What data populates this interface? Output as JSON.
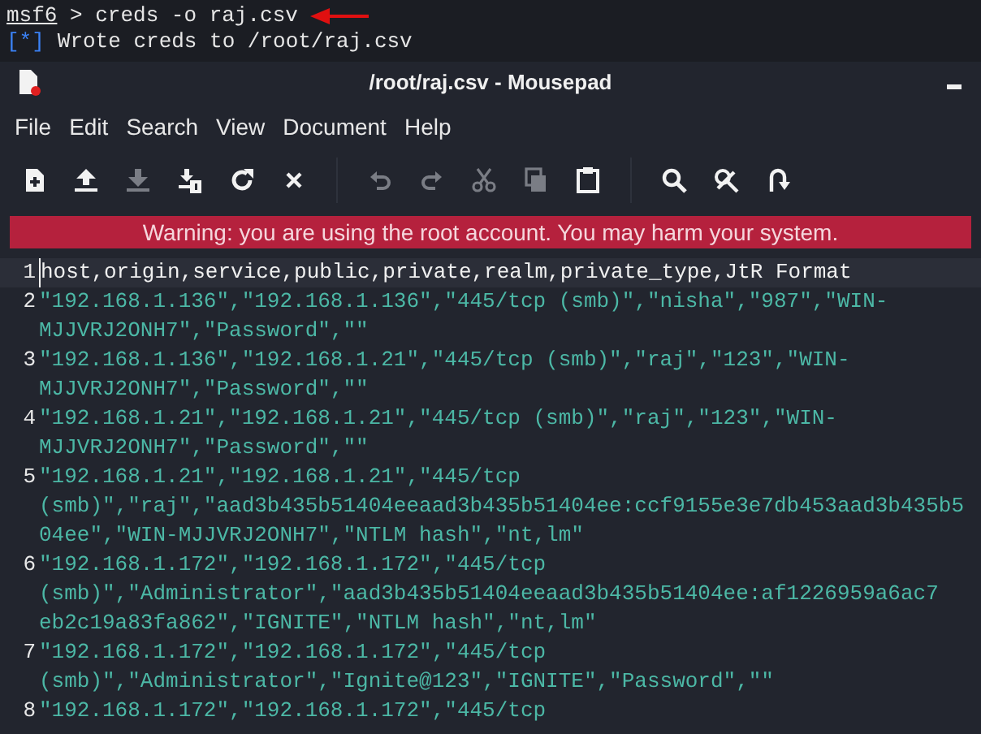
{
  "terminal": {
    "prompt": "msf6",
    "command": " > creds -o raj.csv",
    "output_marker": "[*]",
    "output": "Wrote creds to /root/raj.csv"
  },
  "window": {
    "title": "/root/raj.csv - Mousepad"
  },
  "menu": [
    "File",
    "Edit",
    "Search",
    "View",
    "Document",
    "Help"
  ],
  "toolbar": [
    {
      "kind": "new",
      "disabled": false
    },
    {
      "kind": "open",
      "disabled": false
    },
    {
      "kind": "save",
      "disabled": true
    },
    {
      "kind": "save-as",
      "disabled": false
    },
    {
      "kind": "reload",
      "disabled": false
    },
    {
      "kind": "close",
      "disabled": false
    },
    {
      "kind": "sep"
    },
    {
      "kind": "undo",
      "disabled": true
    },
    {
      "kind": "redo",
      "disabled": true
    },
    {
      "kind": "cut",
      "disabled": true
    },
    {
      "kind": "copy",
      "disabled": true
    },
    {
      "kind": "paste",
      "disabled": false
    },
    {
      "kind": "sep"
    },
    {
      "kind": "find",
      "disabled": false
    },
    {
      "kind": "replace",
      "disabled": false
    },
    {
      "kind": "goto",
      "disabled": false
    }
  ],
  "warning": "Warning: you are using the root account. You may harm your system.",
  "lines": [
    {
      "number": "1",
      "current": true,
      "header": true,
      "rows": [
        "host,origin,service,public,private,realm,private_type,JtR Format"
      ]
    },
    {
      "number": "2",
      "current": false,
      "header": false,
      "rows": [
        "\"192.168.1.136\",\"192.168.1.136\",\"445/tcp (smb)\",\"nisha\",\"987\",\"WIN-",
        "MJJVRJ2ONH7\",\"Password\",\"\""
      ]
    },
    {
      "number": "3",
      "current": false,
      "header": false,
      "rows": [
        "\"192.168.1.136\",\"192.168.1.21\",\"445/tcp (smb)\",\"raj\",\"123\",\"WIN-",
        "MJJVRJ2ONH7\",\"Password\",\"\""
      ]
    },
    {
      "number": "4",
      "current": false,
      "header": false,
      "rows": [
        "\"192.168.1.21\",\"192.168.1.21\",\"445/tcp (smb)\",\"raj\",\"123\",\"WIN-",
        "MJJVRJ2ONH7\",\"Password\",\"\""
      ]
    },
    {
      "number": "5",
      "current": false,
      "header": false,
      "rows": [
        "\"192.168.1.21\",\"192.168.1.21\",\"445/tcp",
        "(smb)\",\"raj\",\"aad3b435b51404eeaad3b435b51404ee:ccf9155e3e7db453aad3b435b5",
        "04ee\",\"WIN-MJJVRJ2ONH7\",\"NTLM hash\",\"nt,lm\""
      ]
    },
    {
      "number": "6",
      "current": false,
      "header": false,
      "rows": [
        "\"192.168.1.172\",\"192.168.1.172\",\"445/tcp",
        "(smb)\",\"Administrator\",\"aad3b435b51404eeaad3b435b51404ee:af1226959a6ac7",
        "eb2c19a83fa862\",\"IGNITE\",\"NTLM hash\",\"nt,lm\""
      ]
    },
    {
      "number": "7",
      "current": false,
      "header": false,
      "rows": [
        "\"192.168.1.172\",\"192.168.1.172\",\"445/tcp",
        "(smb)\",\"Administrator\",\"Ignite@123\",\"IGNITE\",\"Password\",\"\""
      ]
    },
    {
      "number": "8",
      "current": false,
      "header": false,
      "rows": [
        "\"192.168.1.172\",\"192.168.1.172\",\"445/tcp"
      ]
    }
  ]
}
